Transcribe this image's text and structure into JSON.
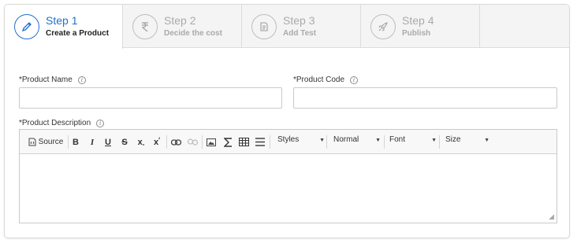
{
  "steps": [
    {
      "title": "Step 1",
      "subtitle": "Create a Product",
      "icon": "pencil-icon",
      "active": true
    },
    {
      "title": "Step 2",
      "subtitle": "Decide the cost",
      "icon": "rupee-icon",
      "active": false
    },
    {
      "title": "Step 3",
      "subtitle": "Add Test",
      "icon": "document-icon",
      "active": false
    },
    {
      "title": "Step 4",
      "subtitle": "Publish",
      "icon": "rocket-icon",
      "active": false
    }
  ],
  "form": {
    "product_name": {
      "label": "*Product Name",
      "value": ""
    },
    "product_code": {
      "label": "*Product Code",
      "value": ""
    },
    "product_description": {
      "label": "*Product Description",
      "value": ""
    }
  },
  "toolbar": {
    "source_label": "Source",
    "bold": "B",
    "italic": "I",
    "underline": "U",
    "strike": "S",
    "subscript": "x",
    "superscript": "x",
    "styles_label": "Styles",
    "format_label": "Normal",
    "font_label": "Font",
    "size_label": "Size"
  },
  "colors": {
    "accent": "#1f6fd0",
    "inactive": "#aaaaaa",
    "border": "#c9c9c9"
  }
}
